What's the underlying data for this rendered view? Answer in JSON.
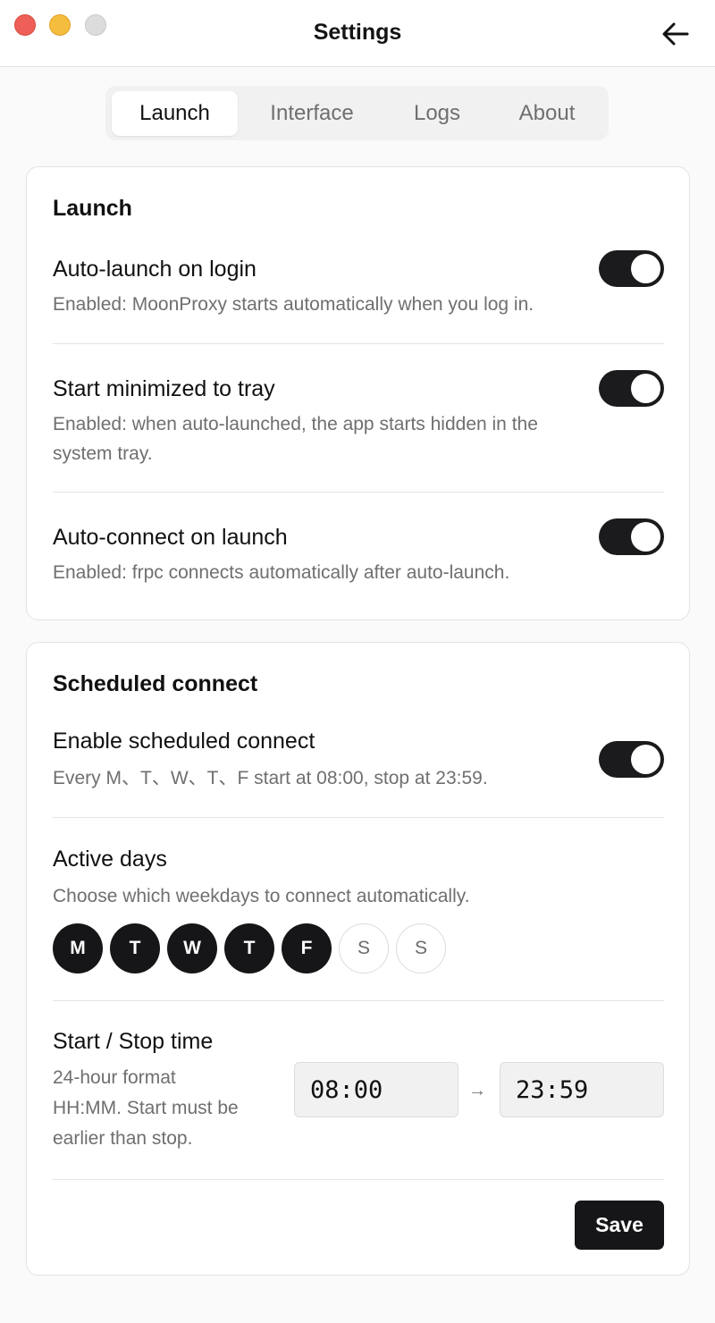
{
  "window": {
    "title": "Settings"
  },
  "tabs": [
    {
      "label": "Launch",
      "active": true
    },
    {
      "label": "Interface",
      "active": false
    },
    {
      "label": "Logs",
      "active": false
    },
    {
      "label": "About",
      "active": false
    }
  ],
  "launch_card": {
    "title": "Launch",
    "rows": [
      {
        "title": "Auto-launch on login",
        "desc": "Enabled: MoonProxy starts automatically when you log in.",
        "enabled": true
      },
      {
        "title": "Start minimized to tray",
        "desc_line1": "Enabled: when auto-launched, the app starts hidden in the",
        "desc_line2": "system tray.",
        "enabled": true
      },
      {
        "title": "Auto-connect on launch",
        "desc": "Enabled: frpc connects automatically after auto-launch.",
        "enabled": true
      }
    ]
  },
  "schedule_card": {
    "title": "Scheduled connect",
    "enable": {
      "title": "Enable scheduled connect",
      "desc": "Every M、T、W、T、F start at 08:00, stop at 23:59.",
      "enabled": true
    },
    "active_days": {
      "title": "Active days",
      "desc": "Choose which weekdays to connect automatically.",
      "days": [
        {
          "label": "M",
          "selected": true
        },
        {
          "label": "T",
          "selected": true
        },
        {
          "label": "W",
          "selected": true
        },
        {
          "label": "T",
          "selected": true
        },
        {
          "label": "F",
          "selected": true
        },
        {
          "label": "S",
          "selected": false
        },
        {
          "label": "S",
          "selected": false
        }
      ]
    },
    "time": {
      "title": "Start / Stop time",
      "desc_line1": "24-hour format",
      "desc_line2": "HH:MM. Start must be",
      "desc_line3": "earlier than stop.",
      "start": "08:00",
      "stop": "23:59",
      "separator": "→"
    },
    "save_label": "Save"
  },
  "colors": {
    "accent": "#161618",
    "muted_text": "#6f6f6f",
    "traffic_red": "#ee5f58",
    "traffic_yellow": "#f5bd3e",
    "traffic_gray": "#dcdcdc"
  },
  "icons": {
    "back": "arrow-left-icon"
  }
}
